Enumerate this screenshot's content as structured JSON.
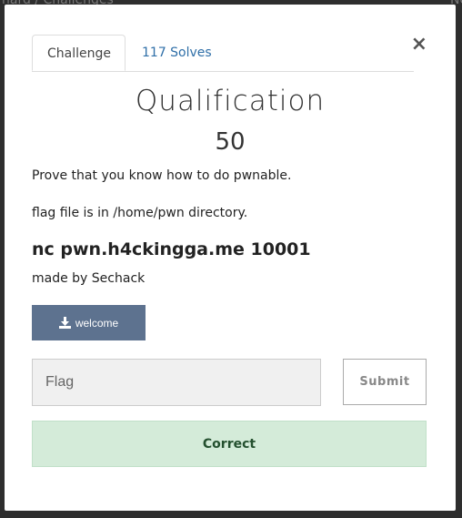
{
  "background": {
    "left_text": "nard / Challenges",
    "right_text": "Ne"
  },
  "modal": {
    "close_label": "×",
    "tabs": [
      {
        "label": "Challenge"
      },
      {
        "label": "117 Solves"
      }
    ],
    "challenge": {
      "title": "Qualification",
      "points": "50",
      "description_lines": [
        "Prove that you know how to do pwnable.",
        "flag file is in /home/pwn directory.",
        "nc pwn.h4ckingga.me 10001",
        "made by Sechack"
      ],
      "file_button_label": "welcome",
      "file_icon": "download-icon"
    },
    "flag_input": {
      "value": "",
      "placeholder": "Flag"
    },
    "submit_label": "Submit",
    "result_message": "Correct"
  },
  "colors": {
    "file_button": "#5d728f",
    "tab_link": "#2f6fa8",
    "success_bg": "#d4ebd9",
    "success_text": "#24502f"
  }
}
